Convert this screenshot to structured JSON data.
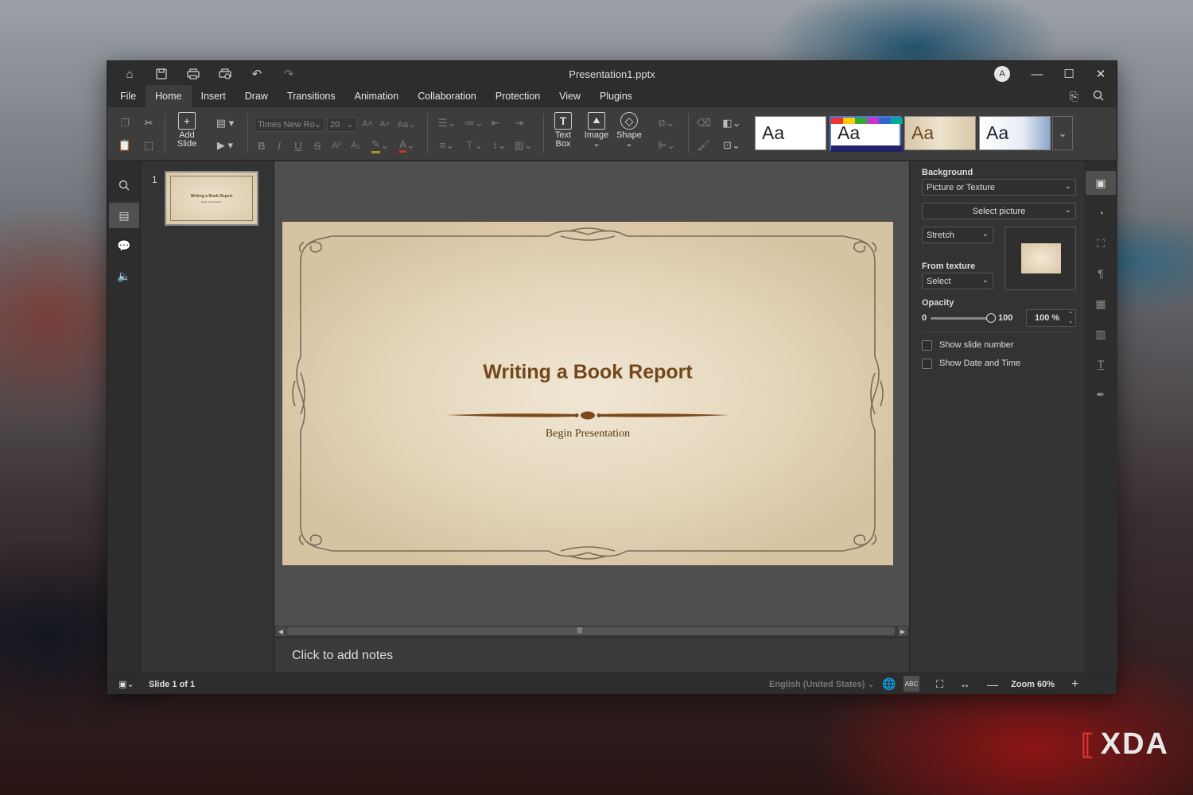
{
  "window": {
    "title": "Presentation1.pptx",
    "avatar_initial": "A"
  },
  "menu": {
    "items": [
      "File",
      "Home",
      "Insert",
      "Draw",
      "Transitions",
      "Animation",
      "Collaboration",
      "Protection",
      "View",
      "Plugins"
    ],
    "active": "Home"
  },
  "ribbon": {
    "add_slide_line1": "Add",
    "add_slide_line2": "Slide",
    "font_name": "Times New Ro",
    "font_size": "20",
    "text_box_line1": "Text",
    "text_box_line2": "Box",
    "image_label": "Image",
    "shape_label": "Shape",
    "themes": [
      "Aa",
      "Aa",
      "Aa",
      "Aa"
    ]
  },
  "thumbnails": {
    "number": "1",
    "title": "Writing a Book Report",
    "subtitle": "Begin Presentation"
  },
  "slide": {
    "title": "Writing a Book Report",
    "subtitle": "Begin Presentation"
  },
  "notes": {
    "placeholder": "Click to add notes"
  },
  "background_panel": {
    "section_label": "Background",
    "fill_type": "Picture or Texture",
    "select_picture": "Select picture",
    "stretch": "Stretch",
    "from_texture_label": "From texture",
    "texture_select": "Select",
    "opacity_label": "Opacity",
    "opacity_min": "0",
    "opacity_max": "100",
    "opacity_value": "100 %",
    "opacity_fraction": 1.0,
    "show_slide_number": "Show slide number",
    "show_date_time": "Show Date and Time"
  },
  "status": {
    "slide_info": "Slide 1 of 1",
    "language": "English (United States)",
    "zoom": "Zoom 60%"
  },
  "watermark": {
    "text": "XDA"
  },
  "colors": {
    "title_brown": "#74471a",
    "app_dark": "#2d2d2d",
    "ribbon": "#3d3d3d"
  }
}
